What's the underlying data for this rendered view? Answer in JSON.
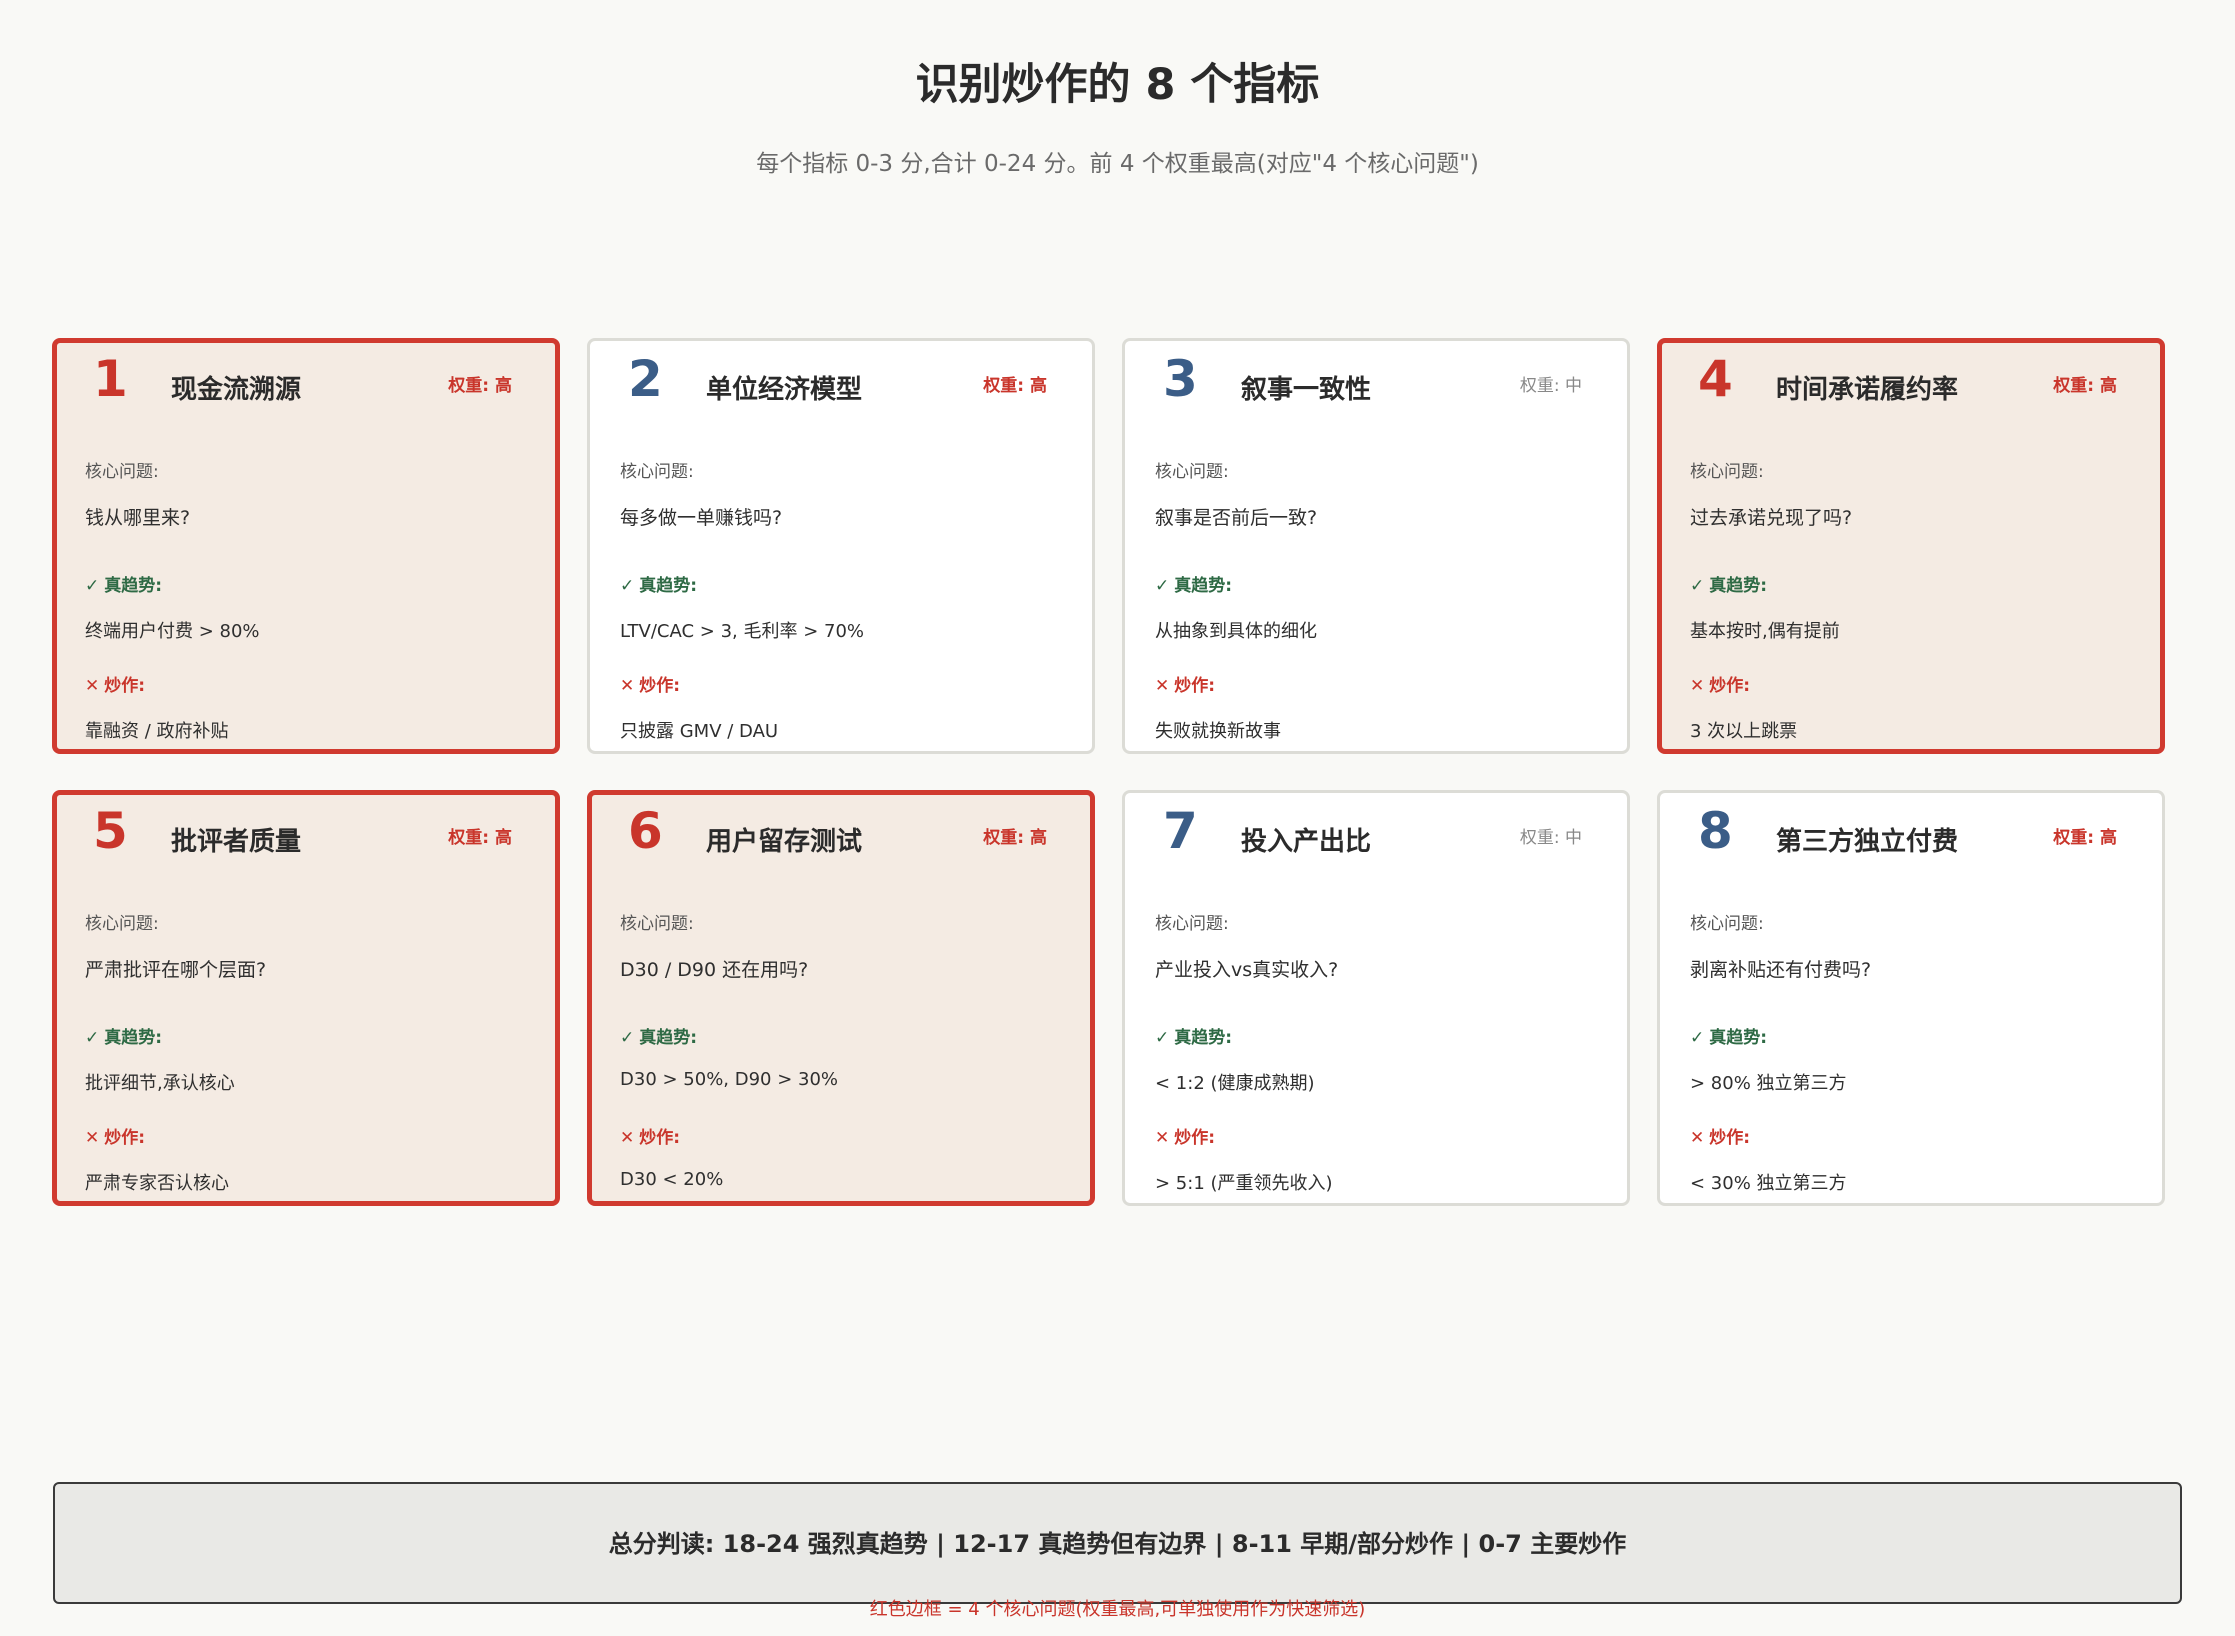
{
  "page": {
    "title": "识别炒作的 8 个指标",
    "subtitle": "每个指标 0-3 分,合计 0-24 分。前 4 个权重最高(对应\"4 个核心问题\")"
  },
  "colors": {
    "core_border": "#d03a2f",
    "core_background": "#f4ebe3",
    "number_blue": "#3b5d87",
    "true_green": "#2e6a45",
    "hype_red": "#c9352b"
  },
  "labels": {
    "question": "核心问题:",
    "true_trend": "真趋势:",
    "hype": "炒作:",
    "check_icon": "check-icon",
    "cross_icon": "cross-icon"
  },
  "indicators": [
    {
      "number": "1",
      "title": "现金流溯源",
      "weight": "权重: 高",
      "core": true,
      "question": "钱从哪里来?",
      "true_trend": "终端用户付费 > 80%",
      "hype": "靠融资 / 政府补贴"
    },
    {
      "number": "2",
      "title": "单位经济模型",
      "weight": "权重: 高",
      "core": false,
      "question": "每多做一单赚钱吗?",
      "true_trend": "LTV/CAC > 3, 毛利率 > 70%",
      "hype": "只披露 GMV / DAU"
    },
    {
      "number": "3",
      "title": "叙事一致性",
      "weight": "权重: 中",
      "core": false,
      "question": "叙事是否前后一致?",
      "true_trend": "从抽象到具体的细化",
      "hype": "失败就换新故事"
    },
    {
      "number": "4",
      "title": "时间承诺履约率",
      "weight": "权重: 高",
      "core": true,
      "question": "过去承诺兑现了吗?",
      "true_trend": "基本按时,偶有提前",
      "hype": "3 次以上跳票"
    },
    {
      "number": "5",
      "title": "批评者质量",
      "weight": "权重: 高",
      "core": true,
      "question": "严肃批评在哪个层面?",
      "true_trend": "批评细节,承认核心",
      "hype": "严肃专家否认核心"
    },
    {
      "number": "6",
      "title": "用户留存测试",
      "weight": "权重: 高",
      "core": true,
      "question": "D30 / D90 还在用吗?",
      "true_trend": "D30 > 50%, D90 > 30%",
      "hype": "D30 < 20%"
    },
    {
      "number": "7",
      "title": "投入产出比",
      "weight": "权重: 中",
      "core": false,
      "question": "产业投入vs真实收入?",
      "true_trend": "< 1:2 (健康成熟期)",
      "hype": "> 5:1 (严重领先收入)"
    },
    {
      "number": "8",
      "title": "第三方独立付费",
      "weight": "权重: 高",
      "core": false,
      "question": "剥离补贴还有付费吗?",
      "true_trend": "> 80% 独立第三方",
      "hype": "< 30% 独立第三方"
    }
  ],
  "summary": {
    "text": "总分判读: 18-24 强烈真趋势 | 12-17 真趋势但有边界 | 8-11 早期/部分炒作 | 0-7 主要炒作"
  },
  "footnote": "红色边框 = 4 个核心问题(权重最高,可单独使用作为快速筛选)"
}
